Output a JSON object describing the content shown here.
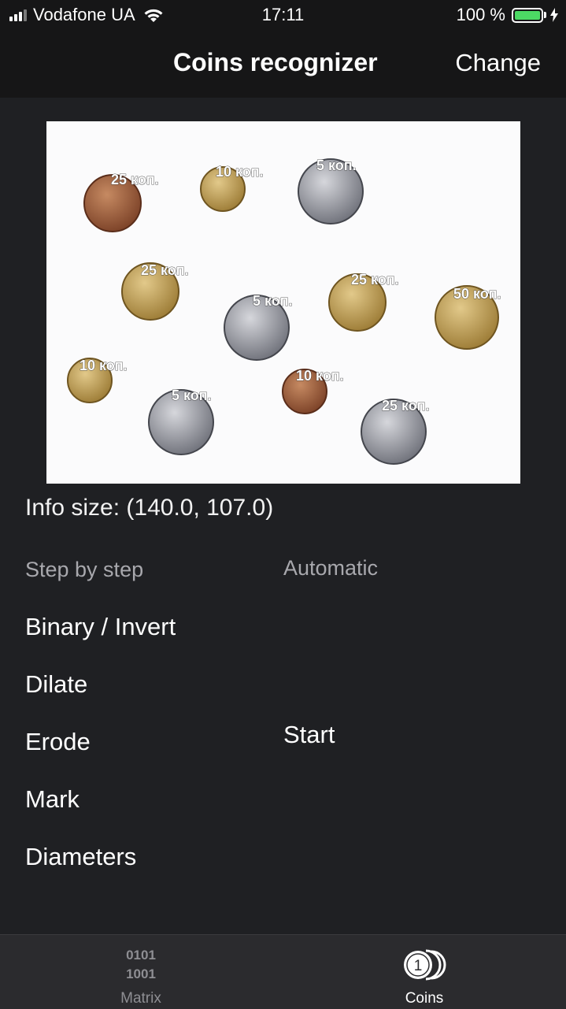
{
  "status_bar": {
    "carrier": "Vodafone UA",
    "time": "17:11",
    "battery": "100 %"
  },
  "nav": {
    "title": "Coins recognizer",
    "right_button": "Change"
  },
  "photo": {
    "coin_labels": [
      "25 коп.",
      "10 коп.",
      "5 коп.",
      "25 коп.",
      "5 коп.",
      "25 коп.",
      "50 коп.",
      "10 коп.",
      "10 коп.",
      "5 коп.",
      "25 коп."
    ]
  },
  "info": "Info  size: (140.0, 107.0)",
  "step_by_step": {
    "label": "Step by step",
    "actions": [
      "Binary / Invert",
      "Dilate",
      "Erode",
      "Mark",
      "Diameters"
    ]
  },
  "automatic": {
    "label": "Automatic",
    "start": "Start"
  },
  "tab_bar": {
    "tabs": [
      {
        "label": "Matrix",
        "icon": "matrix-icon",
        "icon_text_1": "0101",
        "icon_text_2": "1001"
      },
      {
        "label": "Coins",
        "icon": "coins-icon",
        "icon_text": "1"
      }
    ]
  },
  "colors": {
    "background": "#1f2023",
    "bars": "#161617",
    "tab_bar": "#2b2b2e",
    "battery": "#4cd964",
    "secondary_text": "#a8a8ad"
  }
}
